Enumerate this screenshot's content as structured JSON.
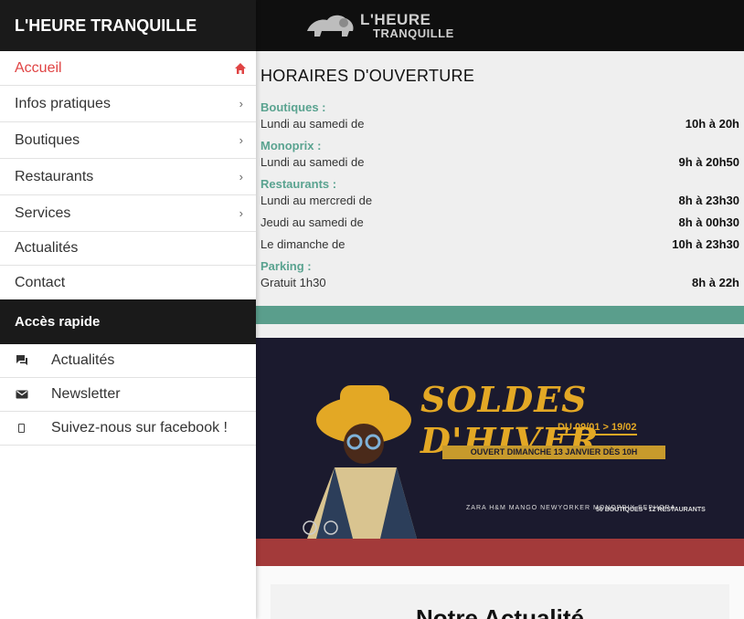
{
  "brand": {
    "logo_line1": "L'HEURE",
    "logo_line2": "TRANQUILLE"
  },
  "drawer": {
    "title": "L'HEURE TRANQUILLE",
    "nav": [
      {
        "label": "Accueil",
        "icon": "home-icon",
        "active": true
      },
      {
        "label": "Infos pratiques",
        "icon": "chevron-right-icon"
      },
      {
        "label": "Boutiques",
        "icon": "chevron-right-icon"
      },
      {
        "label": "Restaurants",
        "icon": "chevron-right-icon"
      },
      {
        "label": "Services",
        "icon": "chevron-right-icon"
      },
      {
        "label": "Actualités"
      },
      {
        "label": "Contact"
      }
    ],
    "quick_title": "Accès rapide",
    "quick": [
      {
        "label": "Actualités",
        "icon": "chat-icon"
      },
      {
        "label": "Newsletter",
        "icon": "mail-icon"
      },
      {
        "label": "Suivez-nous sur facebook !",
        "icon": "facebook-icon"
      }
    ]
  },
  "hours": {
    "title": "HORAIRES D'OUVERTURE",
    "boutiques": {
      "label": "Boutiques :",
      "days": "Lundi au samedi de",
      "time": "10h à 20h"
    },
    "monoprix": {
      "label": "Monoprix :",
      "days": "Lundi au samedi de",
      "time": "9h à 20h50"
    },
    "restaurants": {
      "label": "Restaurants :",
      "rows": [
        {
          "days": "Lundi au mercredi de",
          "time": "8h à 23h30"
        },
        {
          "days": "Jeudi au samedi de",
          "time": "8h à 00h30"
        },
        {
          "days": "Le dimanche de",
          "time": "10h à 23h30"
        }
      ]
    },
    "parking": {
      "label": "Parking :",
      "days": "Gratuit 1h30",
      "time": "8h à 22h"
    }
  },
  "banner": {
    "title": "SOLDES D'HIVER",
    "dates": "DU 09/01 > 19/02",
    "opened": "OUVERT DIMANCHE 13 JANVIER DÈS 10H",
    "brands": "ZARA  H&M  MANGO  NEWYORKER  MONOPRIX  SEPHORA",
    "counts": "50 BOUTIQUES • 12 RESTAURANTS"
  },
  "news": {
    "title": "Notre Actualité"
  },
  "colors": {
    "accent_red": "#e04444",
    "teal": "#5a9e8c",
    "gold": "#e3a825",
    "dark": "#1a1a1a"
  }
}
